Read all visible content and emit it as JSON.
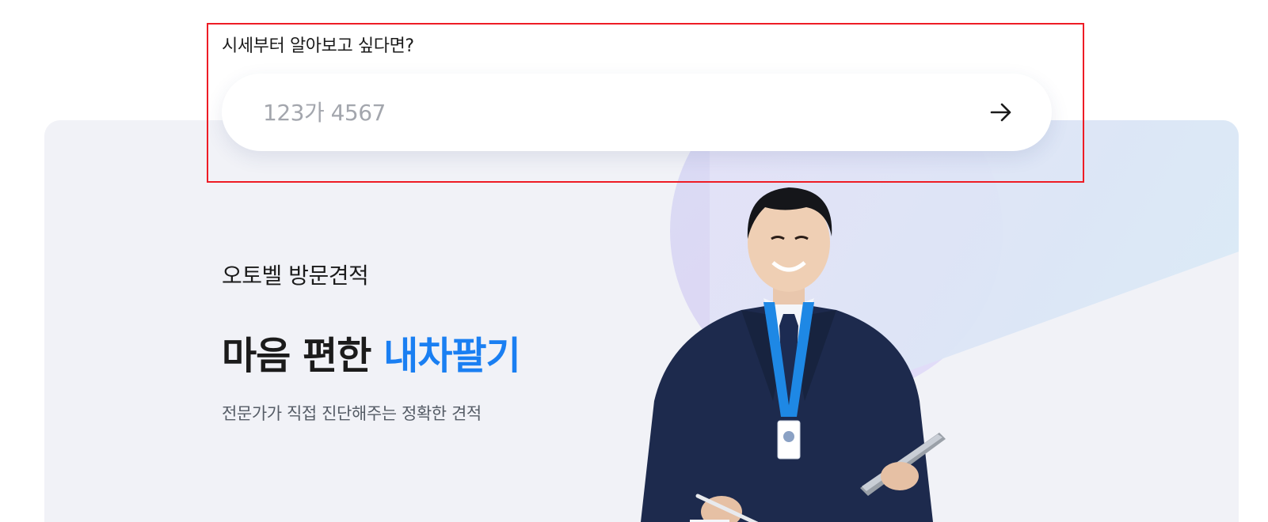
{
  "search": {
    "label": "시세부터 알아보고 싶다면?",
    "placeholder": "123가 4567",
    "value": ""
  },
  "hero": {
    "subtitle": "오토벨 방문견적",
    "title_prefix": "마음 편한 ",
    "title_accent": "내차팔기",
    "description": "전문가가 직접 진단해주는 정확한 견적"
  },
  "colors": {
    "accent": "#1a7ff2",
    "card_background": "#f1f2f7",
    "highlight_border": "#ee1c25",
    "navy_suit": "#1d2a4d",
    "lanyard": "#1e88e5"
  },
  "icons": {
    "submit": "arrow-right-icon"
  }
}
